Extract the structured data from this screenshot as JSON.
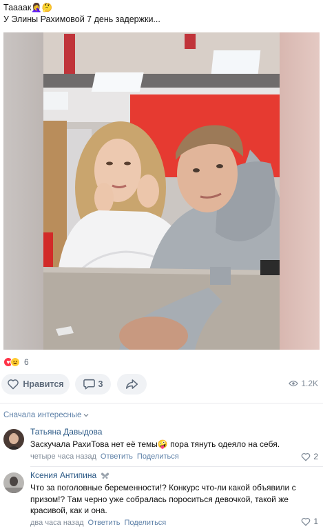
{
  "post": {
    "text_line1": "Таааак🤦‍♀️🤔",
    "text_line2": "У Элины Рахимовой 7 день задержки..."
  },
  "reactions": {
    "count": "6",
    "icons": [
      "heart-icon",
      "laugh-icon"
    ]
  },
  "actions": {
    "like_label": "Нравится",
    "comments_count": "3",
    "views": "1.2K"
  },
  "comments_section": {
    "sort_label": "Сначала интересные"
  },
  "comments": [
    {
      "author": "Татьяна Давыдова",
      "text": "Заскучала РахиТова нет её темы🤪 пора тянуть одеяло на себя.",
      "time": "четыре часа назад",
      "reply_label": "Ответить",
      "share_label": "Поделиться",
      "likes": "2"
    },
    {
      "author": "Ксения Антипина",
      "text": "Что за поголовные беременности!? Конкурс что-ли какой объявили с призом!? Там черно уже собралась пороситься девочкой, такой же красивой, как и она.",
      "time": "два часа назад",
      "reply_label": "Ответить",
      "share_label": "Поделиться",
      "likes": "1"
    }
  ],
  "colors": {
    "link": "#2a5885",
    "muted": "#818c99",
    "pill_bg": "#f0f2f5",
    "accent_red": "#e63a31"
  }
}
